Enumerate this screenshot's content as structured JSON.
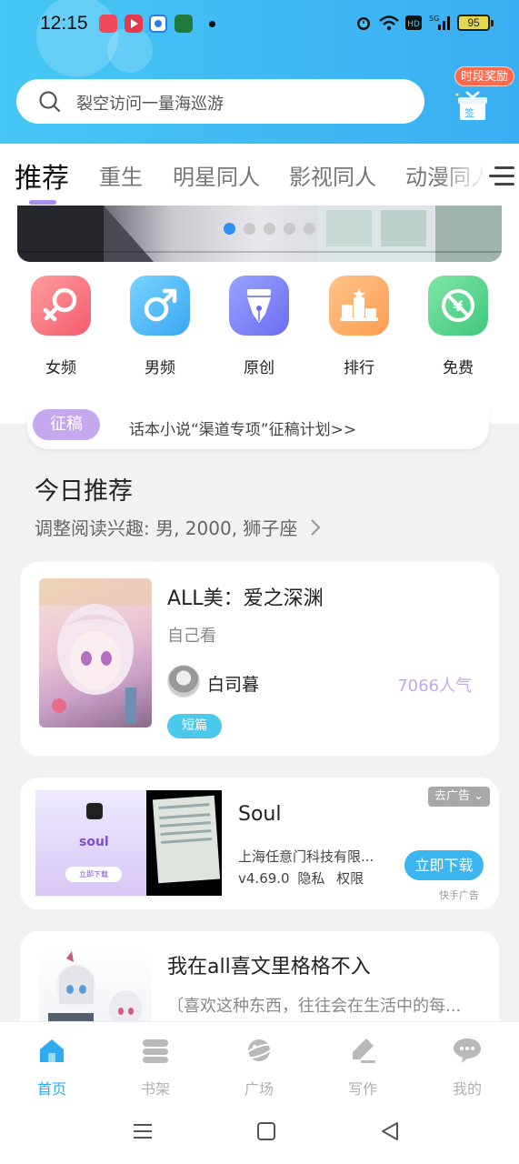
{
  "status_bar": {
    "time": "12:15",
    "battery": "95",
    "icons": [
      "app-red-icon",
      "app-play-icon",
      "app-blue-icon",
      "app-green-icon",
      "alarm-icon",
      "wifi-icon",
      "hd-icon",
      "signal-5g-icon"
    ]
  },
  "header": {
    "search_text": "裂空访问一量海巡游",
    "reward_badge": "时段奖励",
    "gift_label": "签",
    "color_from": "#46c7f5",
    "color_to": "#3aaef2"
  },
  "tabs": [
    "推荐",
    "重生",
    "明星同人",
    "影视同人",
    "动漫同人"
  ],
  "banner": {
    "dots": 5,
    "active_dot": 0
  },
  "categories": [
    {
      "label": "女频",
      "icon": "female-icon"
    },
    {
      "label": "男频",
      "icon": "male-icon"
    },
    {
      "label": "原创",
      "icon": "pen-nib-icon"
    },
    {
      "label": "排行",
      "icon": "ranking-icon"
    },
    {
      "label": "免费",
      "icon": "free-icon"
    }
  ],
  "notice": {
    "tag": "征稿",
    "text": "话本小说“渠道专项”征稿计划>>"
  },
  "recommend": {
    "title": "今日推荐",
    "subtitle": "调整阅读兴趣: 男, 2000, 狮子座",
    "books": [
      {
        "title": "ALL美：爱之深渊",
        "desc": "自己看",
        "author": "白司暮",
        "popularity": "7066人气",
        "tag": "短篇"
      },
      {
        "title": "我在all喜文里格格不入",
        "desc": "〔喜欢这种东西，往往会在生活中的每..."
      }
    ]
  },
  "ad": {
    "close_label": "去广告",
    "title": "Soul",
    "company": "上海任意门科技有限...",
    "version": "v4.69.0",
    "privacy": "隐私",
    "permissions": "权限",
    "button": "立即下载",
    "source": "快手广告",
    "image_brand": "soul",
    "image_button": "立即下载"
  },
  "bottom_nav": [
    {
      "label": "首页",
      "icon": "home-icon",
      "active": true
    },
    {
      "label": "书架",
      "icon": "bookshelf-icon",
      "active": false
    },
    {
      "label": "广场",
      "icon": "planet-icon",
      "active": false
    },
    {
      "label": "写作",
      "icon": "write-icon",
      "active": false
    },
    {
      "label": "我的",
      "icon": "chat-bubble-icon",
      "active": false
    }
  ],
  "colors": {
    "accent": "#2eaaf0",
    "tab_underline": "#a890f0",
    "tag_purple": "#c6a8ee",
    "tag_cyan": "#4ac9ea"
  }
}
